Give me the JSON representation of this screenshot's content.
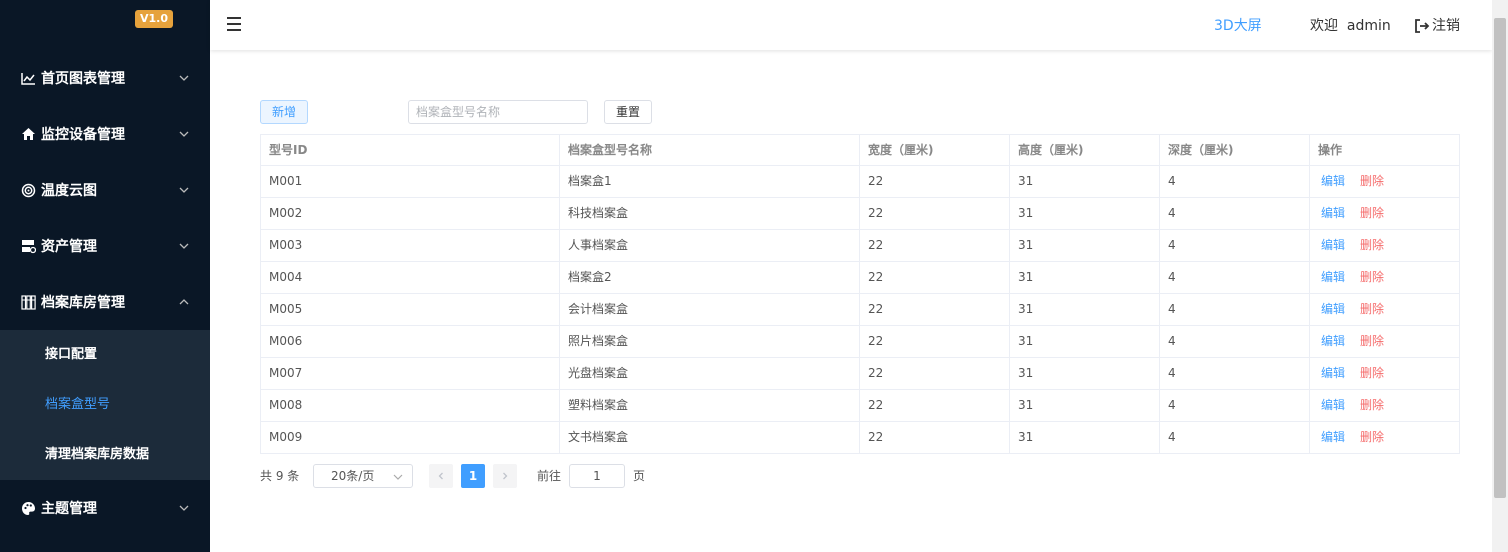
{
  "sidebar": {
    "version": "V1.0",
    "menus": [
      {
        "label": "首页图表管理",
        "icon": "chart-line-icon"
      },
      {
        "label": "监控设备管理",
        "icon": "home-icon"
      },
      {
        "label": "温度云图",
        "icon": "target-icon"
      },
      {
        "label": "资产管理",
        "icon": "server-icon"
      },
      {
        "label": "档案库房管理",
        "icon": "archive-icon"
      },
      {
        "label": "主题管理",
        "icon": "palette-icon"
      }
    ],
    "submenu": [
      {
        "label": "接口配置"
      },
      {
        "label": "档案盒型号"
      },
      {
        "label": "清理档案库房数据"
      }
    ],
    "active_color": "#409eff"
  },
  "header": {
    "link_3d": "3D大屏",
    "welcome": "欢迎  admin",
    "logout": "注销"
  },
  "toolbar": {
    "add_label": "新增",
    "search_placeholder": "档案盒型号名称",
    "reset_label": "重置"
  },
  "table": {
    "columns": [
      "型号ID",
      "档案盒型号名称",
      "宽度（厘米)",
      "高度（厘米)",
      "深度（厘米)",
      "操作"
    ],
    "edit_label": "编辑",
    "delete_label": "删除",
    "rows": [
      {
        "id": "M001",
        "name": "档案盒1",
        "width": "22",
        "height": "31",
        "depth": "4"
      },
      {
        "id": "M002",
        "name": "科技档案盒",
        "width": "22",
        "height": "31",
        "depth": "4"
      },
      {
        "id": "M003",
        "name": "人事档案盒",
        "width": "22",
        "height": "31",
        "depth": "4"
      },
      {
        "id": "M004",
        "name": "档案盒2",
        "width": "22",
        "height": "31",
        "depth": "4"
      },
      {
        "id": "M005",
        "name": "会计档案盒",
        "width": "22",
        "height": "31",
        "depth": "4"
      },
      {
        "id": "M006",
        "name": "照片档案盒",
        "width": "22",
        "height": "31",
        "depth": "4"
      },
      {
        "id": "M007",
        "name": "光盘档案盒",
        "width": "22",
        "height": "31",
        "depth": "4"
      },
      {
        "id": "M008",
        "name": "塑料档案盒",
        "width": "22",
        "height": "31",
        "depth": "4"
      },
      {
        "id": "M009",
        "name": "文书档案盒",
        "width": "22",
        "height": "31",
        "depth": "4"
      }
    ]
  },
  "pagination": {
    "total": "共 9 条",
    "page_size": "20条/页",
    "current": "1",
    "goto_label": "前往",
    "goto_value": "1",
    "page_suffix": "页"
  }
}
